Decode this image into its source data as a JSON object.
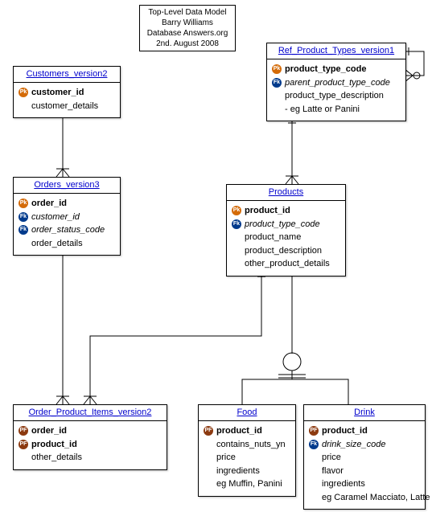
{
  "info": {
    "line1": "Top-Level Data Model",
    "line2": "Barry Williams",
    "line3": "Database Answers.org",
    "line4": "2nd. August 2008"
  },
  "key_labels": {
    "pk": "Pk",
    "fk": "Fk",
    "pf": "PF"
  },
  "entities": {
    "customers": {
      "title": "Customers_version2",
      "attrs": {
        "customer_id": "customer_id",
        "customer_details": "customer_details"
      }
    },
    "orders": {
      "title": "Orders_version3",
      "attrs": {
        "order_id": "order_id",
        "customer_id": "customer_id",
        "order_status_code": "order_status_code",
        "order_details": "order_details"
      }
    },
    "ref_product_types": {
      "title": "Ref_Product_Types_version1",
      "attrs": {
        "product_type_code": "product_type_code",
        "parent_product_type_code": "parent_product_type_code",
        "product_type_description": "product_type_description",
        "example": "- eg Latte or Panini"
      }
    },
    "products": {
      "title": "Products",
      "attrs": {
        "product_id": "product_id",
        "product_type_code": "product_type_code",
        "product_name": "product_name",
        "product_description": "product_description",
        "other_product_details": "other_product_details"
      }
    },
    "order_product_items": {
      "title": "Order_Product_Items_version2",
      "attrs": {
        "order_id": "order_id",
        "product_id": "product_id",
        "other_details": "other_details"
      }
    },
    "food": {
      "title": "Food",
      "attrs": {
        "product_id": "product_id",
        "contains_nuts_yn": "contains_nuts_yn",
        "price": "price",
        "ingredients": "ingredients",
        "example": "eg Muffin, Panini"
      }
    },
    "drink": {
      "title": "Drink",
      "attrs": {
        "product_id": "product_id",
        "drink_size_code": "drink_size_code",
        "price": "price",
        "flavor": "flavor",
        "ingredients": "ingredients",
        "example": "eg Caramel Macciato, Latte"
      }
    }
  }
}
